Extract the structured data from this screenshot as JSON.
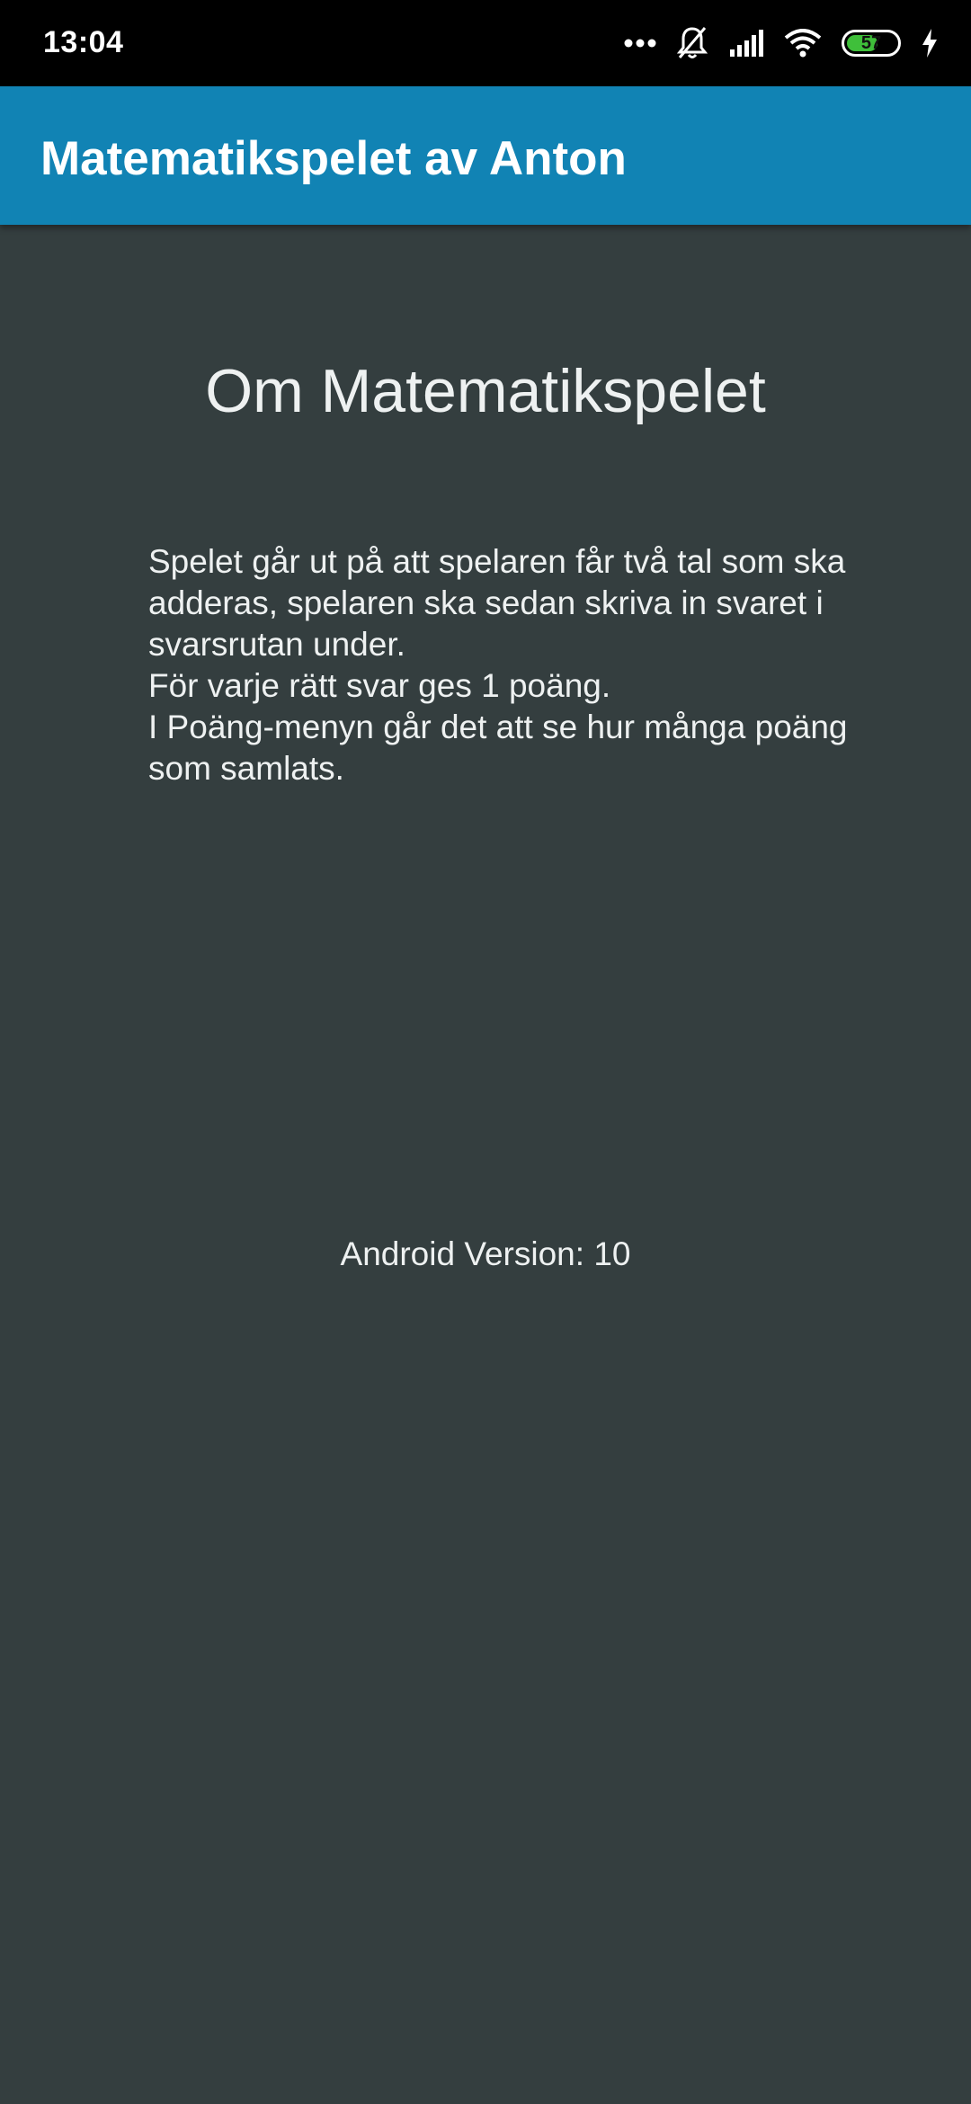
{
  "status_bar": {
    "time": "13:04",
    "battery_level": "57",
    "battery_fraction": 0.57,
    "icons": [
      "more-dots-icon",
      "notifications-off-icon",
      "signal-icon",
      "wifi-icon",
      "battery-icon",
      "charging-icon"
    ]
  },
  "app_bar": {
    "title": "Matematikspelet av Anton",
    "color": "#1183b4"
  },
  "about": {
    "heading": "Om Matematikspelet",
    "lines": [
      "Spelet går ut på att spelaren får två tal som ska adderas, spelaren ska sedan skriva in svaret i svarsrutan under.",
      "För varje rätt svar ges 1 poäng.",
      "I Poäng-menyn går det att se hur många poäng som samlats."
    ],
    "version_text": "Android Version: 10"
  },
  "colors": {
    "background": "#343e3f",
    "text": "#eef1f1",
    "battery_fill": "#3fbf3a"
  }
}
